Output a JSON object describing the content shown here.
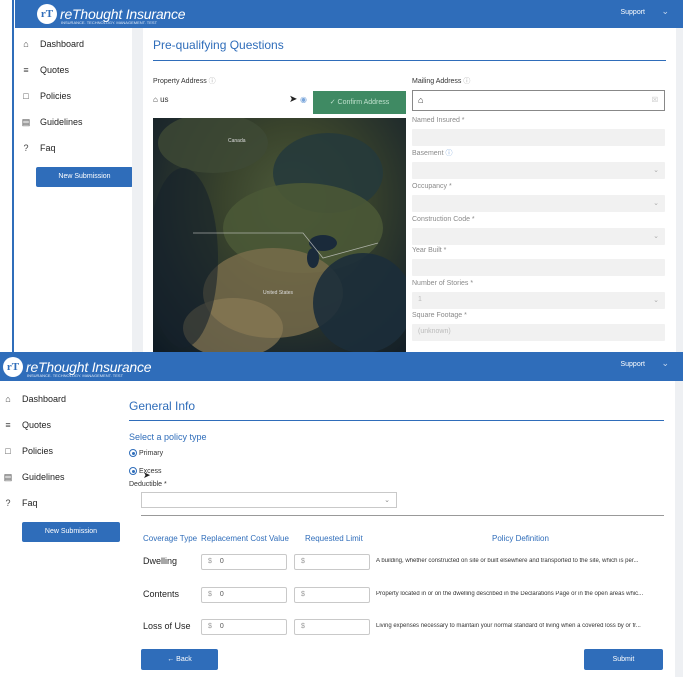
{
  "brand": {
    "mark": "rT",
    "name": "reThought Insurance",
    "tagline": "INSURANCE. TECHNOLOGY. MANAGEMENT. TEST"
  },
  "topbar": {
    "support_label": "Support"
  },
  "sidebar": {
    "items": [
      {
        "label": "Dashboard",
        "icon": "home-icon"
      },
      {
        "label": "Quotes",
        "icon": "list-icon"
      },
      {
        "label": "Policies",
        "icon": "document-icon"
      },
      {
        "label": "Guidelines",
        "icon": "book-icon"
      },
      {
        "label": "Faq",
        "icon": "help-icon"
      }
    ],
    "new_submission_label": "New Submission"
  },
  "prequal": {
    "title": "Pre-qualifying Questions",
    "property_address": {
      "label": "Property Address",
      "value": "us",
      "confirm_label": "Confirm Address"
    },
    "mailing_address": {
      "label": "Mailing Address"
    },
    "named_insured": {
      "label": "Named Insured *"
    },
    "basement": {
      "label": "Basement"
    },
    "occupancy": {
      "label": "Occupancy *"
    },
    "construction_code": {
      "label": "Construction Code *"
    },
    "year_built": {
      "label": "Year Built *"
    },
    "number_of_stories": {
      "label": "Number of Stories *",
      "value": "1"
    },
    "square_footage": {
      "label": "Square Footage *",
      "value": "(unknown)"
    },
    "map_labels": {
      "canada": "Canada",
      "united_states": "United States"
    }
  },
  "general": {
    "title": "General Info",
    "policy_type_heading": "Select a policy type",
    "options": {
      "primary": "Primary",
      "excess": "Excess"
    },
    "deductible_label": "Deductible *",
    "columns": {
      "coverage_type": "Coverage Type",
      "replacement": "Replacement Cost Value",
      "requested": "Requested Limit",
      "definition": "Policy Definition"
    },
    "currency_symbol": "$",
    "rows": [
      {
        "type": "Dwelling",
        "replacement": "0",
        "requested": "",
        "definition": "A building, whether constructed on site or built elsewhere and transported to the site, which is per..."
      },
      {
        "type": "Contents",
        "replacement": "0",
        "requested": "",
        "definition": "Property located in or on the dwelling described in the Declarations Page or in the open areas whic..."
      },
      {
        "type": "Loss of Use",
        "replacement": "0",
        "requested": "",
        "definition": "Living expenses necessary to maintain your normal standard of living when a covered loss by or fr..."
      }
    ],
    "back_label": "← Back",
    "submit_label": "Submit"
  }
}
